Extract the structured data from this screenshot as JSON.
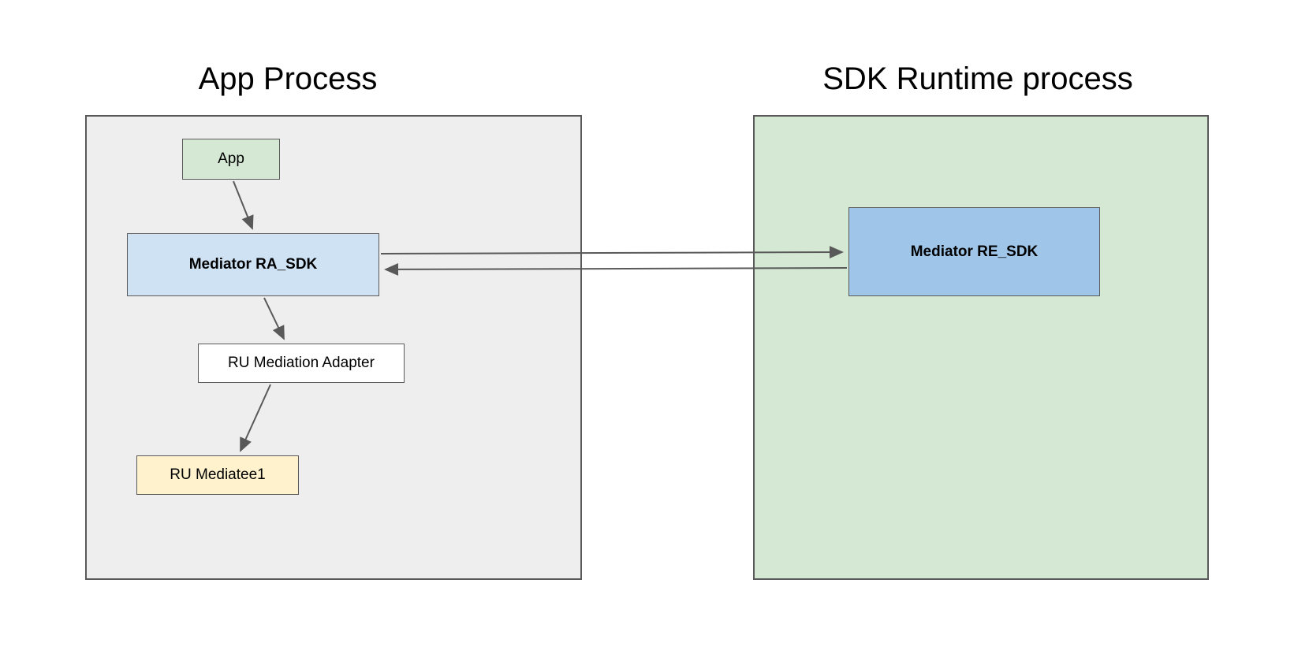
{
  "titles": {
    "app_process": "App Process",
    "sdk_runtime": "SDK Runtime process"
  },
  "boxes": {
    "app": "App",
    "mediator_ra": "Mediator RA_SDK",
    "adapter": "RU Mediation Adapter",
    "mediatee": "RU Mediatee1",
    "mediator_re": "Mediator RE_SDK"
  }
}
